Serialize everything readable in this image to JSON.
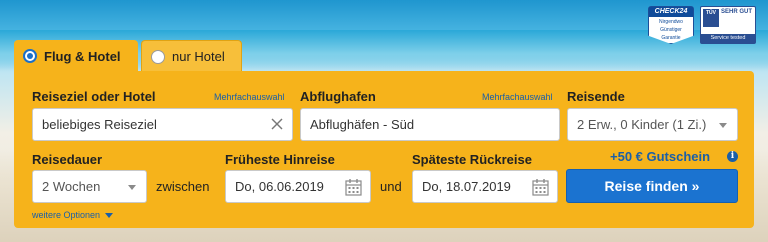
{
  "badges": {
    "check24": {
      "header": "CHECK24",
      "lines": [
        "Nirgendwo",
        "Günstiger",
        "Garantie"
      ]
    },
    "tuv": {
      "logo_top": "TÜV",
      "logo_bottom": "SAARLAND",
      "grade_1": "SEHR GUT",
      "grade_2": "Service tested",
      "footer": "Service tested"
    }
  },
  "tabs": [
    {
      "label": "Flug & Hotel",
      "selected": true
    },
    {
      "label": "nur Hotel",
      "selected": false
    }
  ],
  "form": {
    "destination": {
      "label": "Reiseziel oder Hotel",
      "multi_select": "Mehrfachauswahl",
      "value": "beliebiges Reiseziel"
    },
    "airport": {
      "label": "Abflughafen",
      "multi_select": "Mehrfachauswahl",
      "value": "Abflughäfen - Süd"
    },
    "travelers": {
      "label": "Reisende",
      "value": "2 Erw., 0 Kinder (1 Zi.)"
    },
    "duration": {
      "label": "Reisedauer",
      "value": "2 Wochen"
    },
    "between": "zwischen",
    "earliest": {
      "label": "Früheste Hinreise",
      "value": "Do, 06.06.2019"
    },
    "and": "und",
    "latest": {
      "label": "Späteste Rückreise",
      "value": "Do, 18.07.2019"
    },
    "coupon": "+50 € Gutschein",
    "search_button": "Reise finden »",
    "more_options": "weitere Optionen"
  },
  "colors": {
    "panel": "#f6b31b",
    "accent_blue": "#1a5fa8",
    "button_blue": "#1b73d0"
  }
}
